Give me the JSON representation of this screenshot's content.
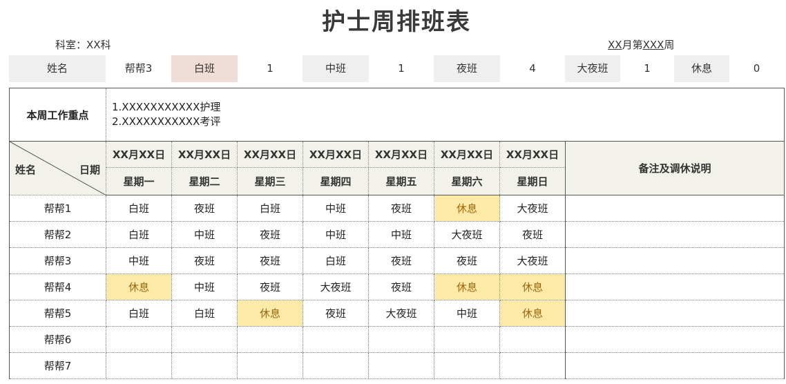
{
  "title": "护士周排班表",
  "department": "科室：XX科",
  "week": {
    "month": "XX",
    "month_suffix": "月第",
    "week_no": "XXX",
    "week_suffix": "周"
  },
  "summary": {
    "name_label": "姓名",
    "name_value": "帮帮3",
    "day_label": "白班",
    "day_value": "1",
    "mid_label": "中班",
    "mid_value": "1",
    "night_label": "夜班",
    "night_value": "4",
    "bignight_label": "大夜班",
    "bignight_value": "1",
    "rest_label": "休息",
    "rest_value": "0"
  },
  "focus": {
    "label": "本周工作重点",
    "line1": "1.XXXXXXXXXXX护理",
    "line2": "2.XXXXXXXXXXX考评"
  },
  "header": {
    "name_label": "姓名",
    "date_label": "日期",
    "dates": [
      "XX月XX日",
      "XX月XX日",
      "XX月XX日",
      "XX月XX日",
      "XX月XX日",
      "XX月XX日",
      "XX月XX日"
    ],
    "weekdays": [
      "星期一",
      "星期二",
      "星期三",
      "星期四",
      "星期五",
      "星期六",
      "星期日"
    ],
    "remarks_label": "备注及调休说明"
  },
  "rows": [
    {
      "name": "帮帮1",
      "shifts": [
        "白班",
        "夜班",
        "白班",
        "中班",
        "夜班",
        "休息",
        "大夜班"
      ]
    },
    {
      "name": "帮帮2",
      "shifts": [
        "白班",
        "中班",
        "夜班",
        "中班",
        "中班",
        "大夜班",
        "夜班"
      ]
    },
    {
      "name": "帮帮3",
      "shifts": [
        "中班",
        "夜班",
        "夜班",
        "白班",
        "夜班",
        "夜班",
        "大夜班"
      ]
    },
    {
      "name": "帮帮4",
      "shifts": [
        "休息",
        "中班",
        "夜班",
        "大夜班",
        "夜班",
        "休息",
        "休息"
      ]
    },
    {
      "name": "帮帮5",
      "shifts": [
        "白班",
        "白班",
        "休息",
        "夜班",
        "大夜班",
        "中班",
        "休息"
      ]
    },
    {
      "name": "帮帮6",
      "shifts": [
        "",
        "",
        "",
        "",
        "",
        "",
        ""
      ]
    },
    {
      "name": "帮帮7",
      "shifts": [
        "",
        "",
        "",
        "",
        "",
        "",
        ""
      ]
    }
  ],
  "colors": {
    "rest_bg": "#fdeaa8",
    "rest_text": "#a0660a",
    "header_bg": "#f2f2ea",
    "day_shift_bg": "#f0dcd7"
  }
}
